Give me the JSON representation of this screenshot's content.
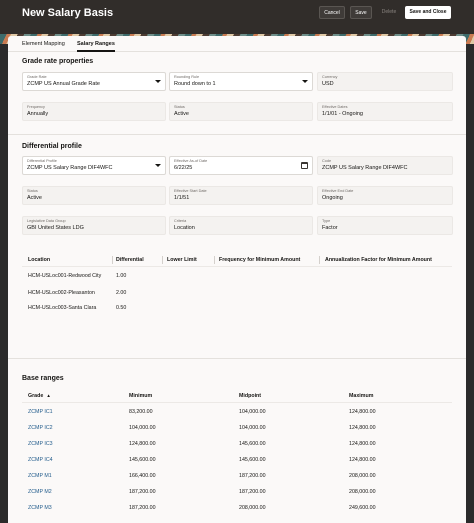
{
  "header": {
    "title": "New Salary Basis",
    "buttons": {
      "cancel": "Cancel",
      "save": "Save",
      "delete": "Delete",
      "save_close": "Save and Close"
    }
  },
  "tabs": [
    "Element Mapping",
    "Salary Ranges"
  ],
  "active_tab": "Salary Ranges",
  "grade_rate": {
    "title": "Grade rate properties",
    "grade_rate": {
      "label": "Grade Rate",
      "value": "ZCMP US Annual Grade Rate"
    },
    "rounding_rule": {
      "label": "Rounding Rule",
      "value": "Round down to 1"
    },
    "currency": {
      "label": "Currency",
      "value": "USD"
    },
    "frequency": {
      "label": "Frequency",
      "value": "Annually"
    },
    "status": {
      "label": "Status",
      "value": "Active"
    },
    "effective_dates": {
      "label": "Effective Dates",
      "value": "1/1/01 - Ongoing"
    }
  },
  "differential": {
    "title": "Differential profile",
    "profile": {
      "label": "Differential Profile",
      "value": "ZCMP US Salary Range DIF4WFC"
    },
    "as_of_date": {
      "label": "Effective As-of Date",
      "value": "6/22/25"
    },
    "code": {
      "label": "Code",
      "value": "ZCMP US Salary Range DIF4WFC"
    },
    "status": {
      "label": "Status",
      "value": "Active"
    },
    "start_date": {
      "label": "Effective Start Date",
      "value": "1/1/51"
    },
    "end_date": {
      "label": "Effective End Date",
      "value": "Ongoing"
    },
    "ldg": {
      "label": "Legislative Data Group",
      "value": "GBI United States LDG"
    },
    "criteria": {
      "label": "Criteria",
      "value": "Location"
    },
    "type": {
      "label": "Type",
      "value": "Factor"
    },
    "table": {
      "headers": [
        "Location",
        "Differential",
        "Lower Limit",
        "Frequency for Minimum Amount",
        "Annualization Factor for Minimum Amount"
      ],
      "rows": [
        [
          "HCM-USLoc001-Redwood City",
          "1.00"
        ],
        [
          "HCM-USLoc002-Pleasanton",
          "2.00"
        ],
        [
          "HCM-USLoc003-Santa Clara",
          "0.50"
        ]
      ]
    }
  },
  "base_ranges": {
    "title": "Base ranges",
    "headers": [
      "Grade",
      "Minimum",
      "Midpoint",
      "Maximum"
    ],
    "sort_glyph": "▲",
    "rows": [
      [
        "ZCMP IC1",
        "83,200.00",
        "104,000.00",
        "124,800.00"
      ],
      [
        "ZCMP IC2",
        "104,000.00",
        "104,000.00",
        "124,800.00"
      ],
      [
        "ZCMP IC3",
        "124,800.00",
        "145,600.00",
        "124,800.00"
      ],
      [
        "ZCMP IC4",
        "145,600.00",
        "145,600.00",
        "124,800.00"
      ],
      [
        "ZCMP M1",
        "166,400.00",
        "187,200.00",
        "208,000.00"
      ],
      [
        "ZCMP M2",
        "187,200.00",
        "187,200.00",
        "208,000.00"
      ],
      [
        "ZCMP M3",
        "187,200.00",
        "208,000.00",
        "249,600.00"
      ]
    ]
  },
  "colors": {
    "header_bg": "#312d2a",
    "link": "#1f5a8a",
    "page_bg": "#fbf9f8"
  }
}
